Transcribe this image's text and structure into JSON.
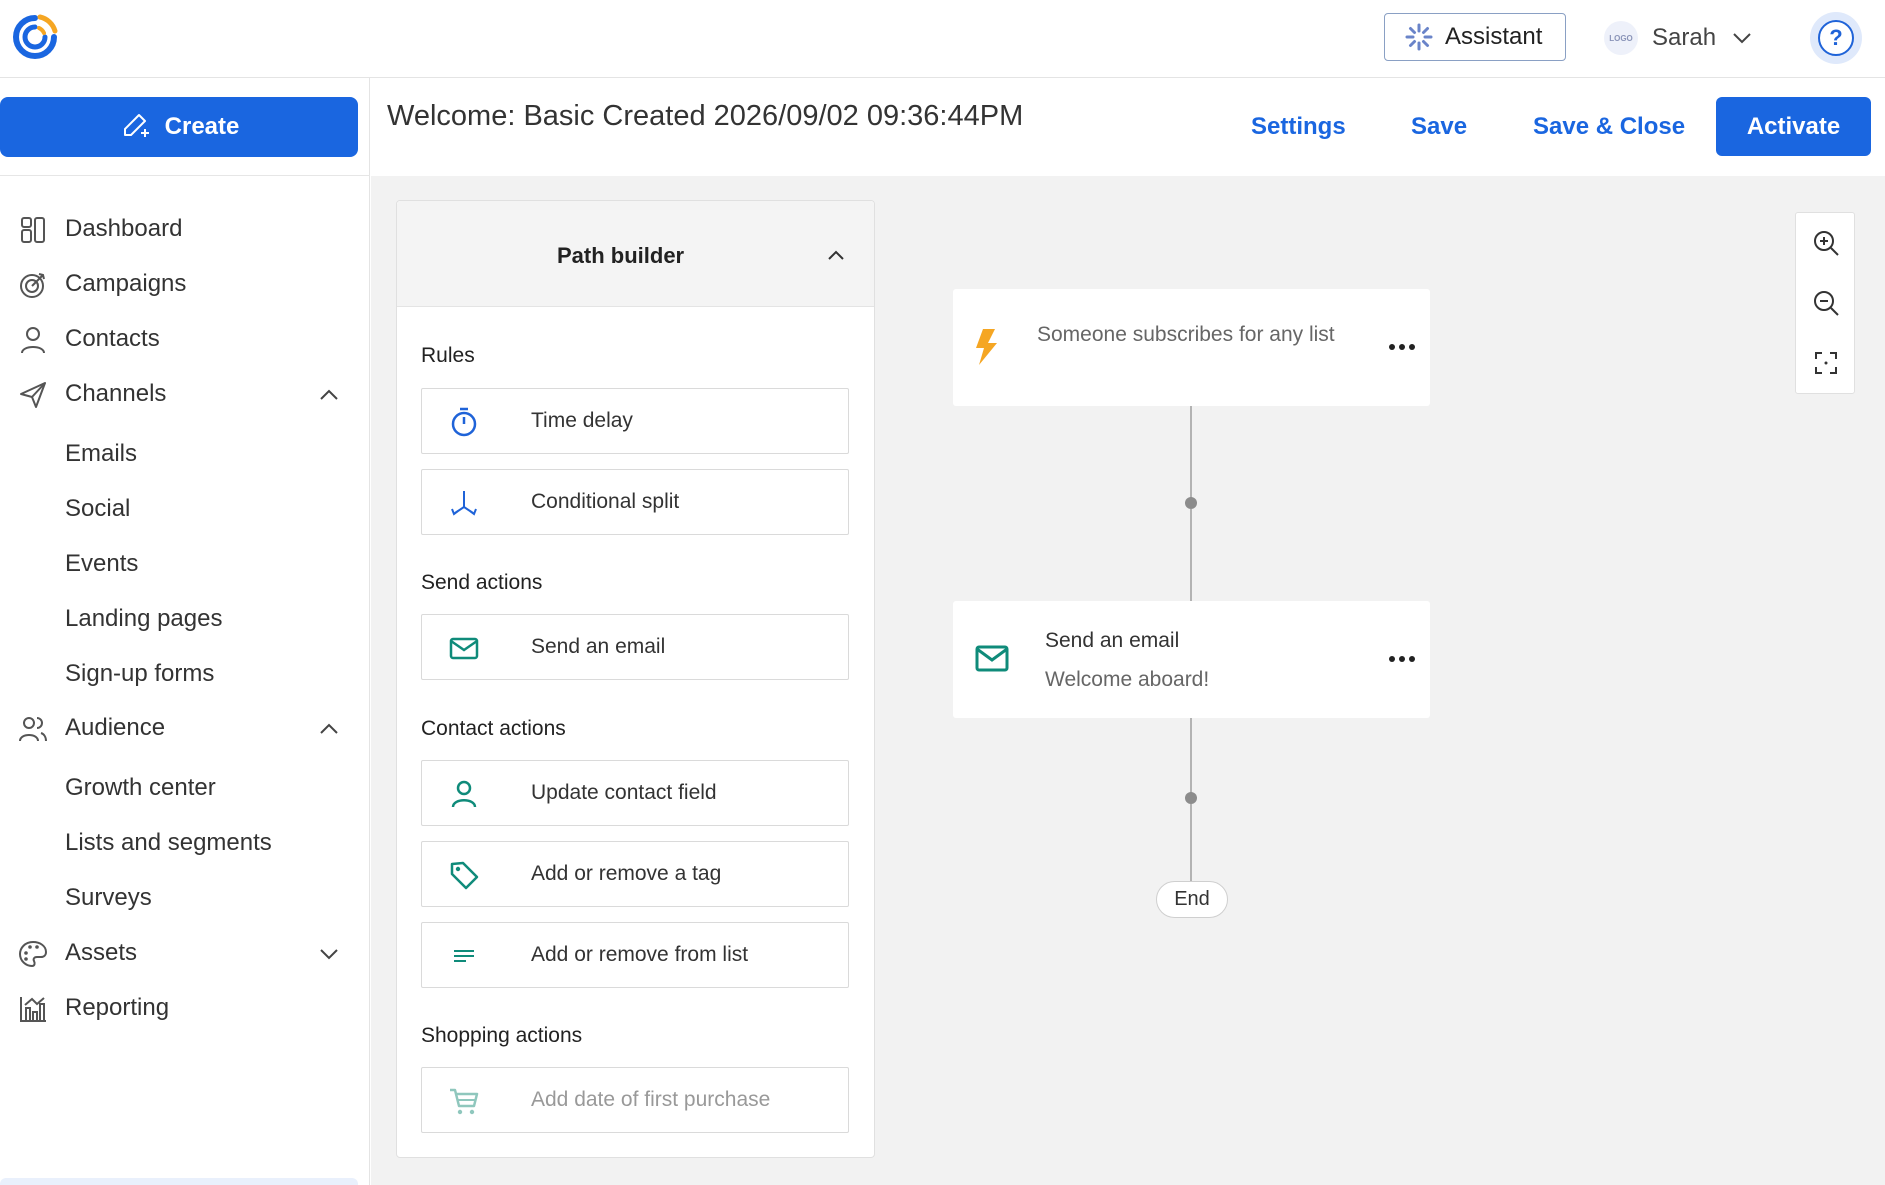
{
  "topbar": {
    "assistant_label": "Assistant",
    "account_logo_text": "LOGO",
    "user_name": "Sarah",
    "help_symbol": "?"
  },
  "sidebar": {
    "create_label": "Create",
    "items": [
      {
        "label": "Dashboard",
        "icon": "dashboard-icon"
      },
      {
        "label": "Campaigns",
        "icon": "target-icon"
      },
      {
        "label": "Contacts",
        "icon": "person-icon"
      },
      {
        "label": "Channels",
        "icon": "paper-plane-icon",
        "expanded": true
      },
      {
        "label": "Emails"
      },
      {
        "label": "Social"
      },
      {
        "label": "Events"
      },
      {
        "label": "Landing pages"
      },
      {
        "label": "Sign-up forms"
      },
      {
        "label": "Audience",
        "icon": "people-icon",
        "expanded": true
      },
      {
        "label": "Growth center"
      },
      {
        "label": "Lists and segments"
      },
      {
        "label": "Surveys"
      },
      {
        "label": "Assets",
        "icon": "palette-icon",
        "expanded": false
      },
      {
        "label": "Reporting",
        "icon": "bar-chart-icon"
      }
    ]
  },
  "header": {
    "title": "Welcome: Basic Created 2026/09/02 09:36:44PM",
    "settings_label": "Settings",
    "save_label": "Save",
    "save_close_label": "Save & Close",
    "activate_label": "Activate"
  },
  "path_builder": {
    "title": "Path builder",
    "sections": {
      "rules": "Rules",
      "send_actions": "Send actions",
      "contact_actions": "Contact actions",
      "shopping_actions": "Shopping actions"
    },
    "cards": {
      "time_delay": "Time delay",
      "conditional_split": "Conditional split",
      "send_email": "Send an email",
      "update_contact_field": "Update contact field",
      "add_remove_tag": "Add or remove a tag",
      "add_remove_list": "Add or remove from list",
      "add_first_purchase": "Add date of first purchase"
    }
  },
  "flow": {
    "trigger_text": "Someone subscribes for any list",
    "email_step_title": "Send an email",
    "email_step_subtitle": "Welcome aboard!",
    "end_label": "End"
  },
  "colors": {
    "primary": "#1a66e0",
    "trigger_bolt": "#f5a623",
    "email_icon": "#0f8b7a",
    "card_icon_blue": "#1f63d8"
  }
}
